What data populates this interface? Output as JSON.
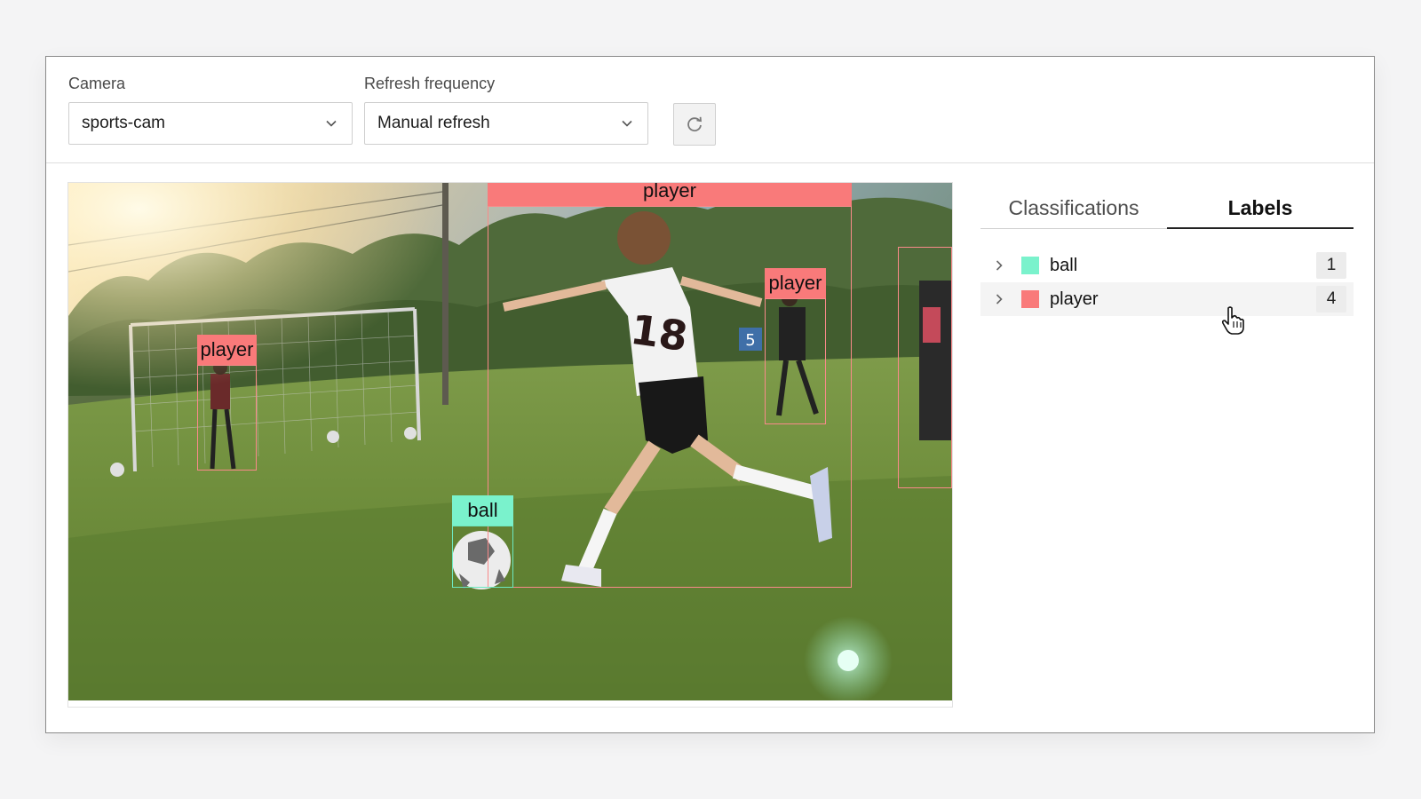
{
  "toolbar": {
    "camera": {
      "label": "Camera",
      "value": "sports-cam"
    },
    "refresh_frequency": {
      "label": "Refresh frequency",
      "value": "Manual refresh"
    },
    "refresh_icon": "refresh-icon"
  },
  "viewer": {
    "detections": [
      {
        "label": "player"
      },
      {
        "label": "player"
      },
      {
        "label": "player"
      },
      {
        "label": "player"
      },
      {
        "label": "ball"
      }
    ]
  },
  "panel": {
    "tabs": [
      {
        "label": "Classifications",
        "active": false
      },
      {
        "label": "Labels",
        "active": true
      }
    ],
    "labels": [
      {
        "name": "ball",
        "count": "1",
        "color": "#7af2cc"
      },
      {
        "name": "player",
        "count": "4",
        "color": "#f97a7a"
      }
    ]
  },
  "colors": {
    "player": "#f97a7a",
    "ball": "#7af2cc",
    "accent": "#222222"
  }
}
